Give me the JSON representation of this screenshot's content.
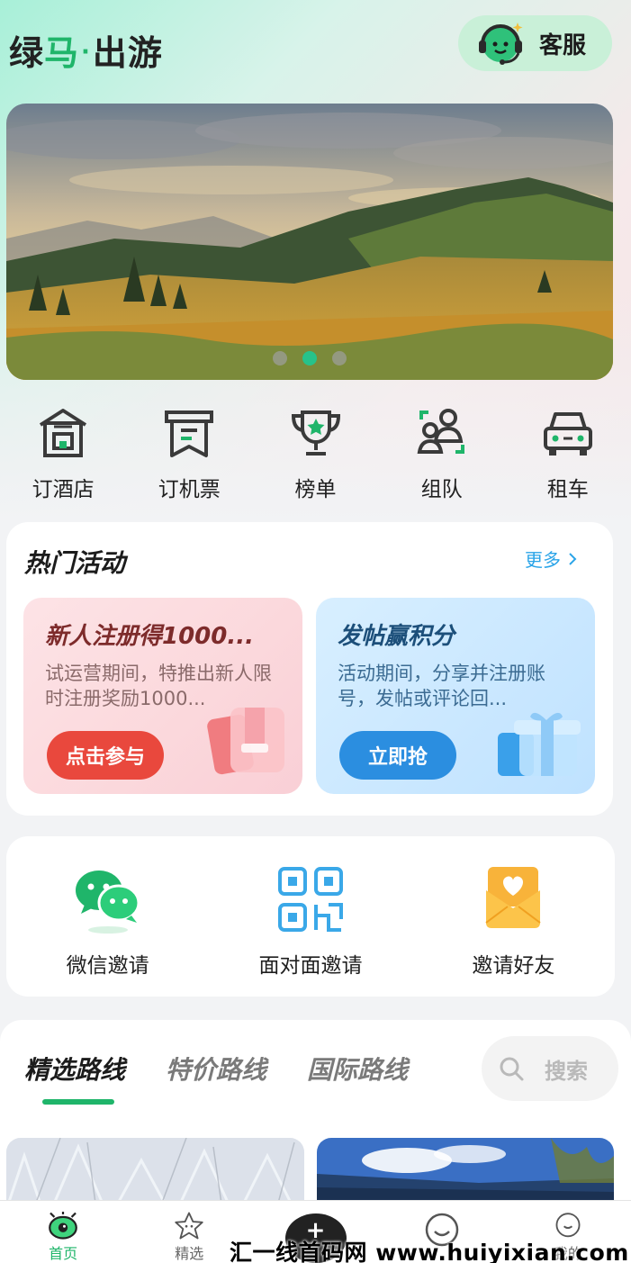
{
  "header": {
    "logo_part1": "绿",
    "logo_part2": "马",
    "logo_dot": "·",
    "logo_part3": "出游",
    "service_label": "客服"
  },
  "banner": {
    "active_slide": 2,
    "slide_count": 3
  },
  "quick_nav": [
    {
      "label": "订酒店",
      "icon": "hotel-icon"
    },
    {
      "label": "订机票",
      "icon": "ticket-icon"
    },
    {
      "label": "榜单",
      "icon": "trophy-icon"
    },
    {
      "label": "组队",
      "icon": "team-icon"
    },
    {
      "label": "租车",
      "icon": "car-icon"
    }
  ],
  "hot": {
    "title": "热门活动",
    "more_label": "更多",
    "activities": [
      {
        "title": "新人注册得1000...",
        "desc": "试运营期间，特推出新人限时注册奖励1000...",
        "button": "点击参与"
      },
      {
        "title": "发帖赢积分",
        "desc": "活动期间，分享并注册账号，发帖或评论回...",
        "button": "立即抢"
      }
    ]
  },
  "invite": [
    {
      "label": "微信邀请",
      "icon": "wechat-icon"
    },
    {
      "label": "面对面邀请",
      "icon": "qrcode-icon"
    },
    {
      "label": "邀请好友",
      "icon": "envelope-heart-icon"
    }
  ],
  "routes": {
    "tabs": [
      "精选路线",
      "特价路线",
      "国际路线"
    ],
    "active_tab": 0,
    "search_label": "搜索"
  },
  "bottom_nav": {
    "items": [
      {
        "label": "首页",
        "icon": "home-eye-icon"
      },
      {
        "label": "精选",
        "icon": "star-icon"
      },
      {
        "label": "",
        "icon": "center-button"
      },
      {
        "label": "",
        "icon": "smile-icon"
      },
      {
        "label": "我的",
        "icon": "profile-icon"
      }
    ]
  },
  "watermark": "汇一线首码网 www.huiyixian.com",
  "colors": {
    "brand_green": "#1fb56a",
    "link_blue": "#2aa4e8",
    "red_button": "#e9483d",
    "blue_button": "#2b8ee0"
  }
}
